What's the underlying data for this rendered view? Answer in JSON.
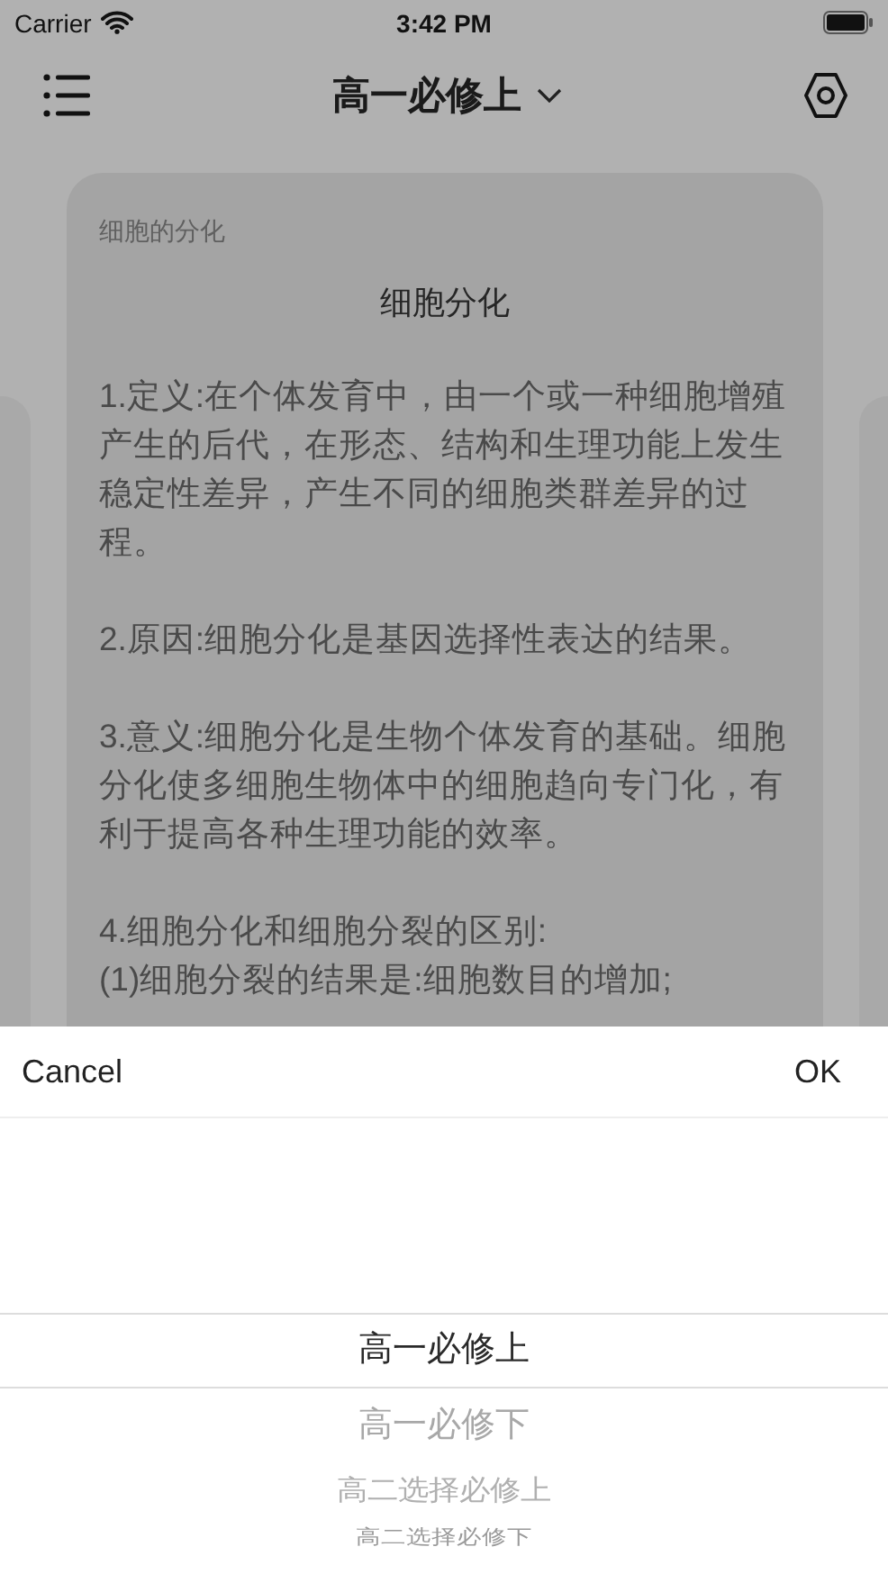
{
  "status_bar": {
    "carrier": "Carrier",
    "time": "3:42 PM"
  },
  "nav_bar": {
    "title": "高一必修上"
  },
  "card": {
    "category": "细胞的分化",
    "heading": "细胞分化",
    "paragraphs": [
      [
        "1.定义:在个体发育中，由一个或一种细胞增殖产生的后代，在形态、结构和生理功能上发生稳定性差异，产生不同的细胞类群差异的过程。"
      ],
      [
        "2.原因:细胞分化是基因选择性表达的结果。"
      ],
      [
        "3.意义:细胞分化是生物个体发育的基础。细胞分化使多细胞生物体中的细胞趋向专门化，有利于提高各种生理功能的效率。"
      ],
      [
        "4.细胞分化和细胞分裂的区别:",
        "(1)细胞分裂的结果是:细胞数目的增加;"
      ]
    ]
  },
  "picker": {
    "cancel": "Cancel",
    "ok": "OK",
    "options": [
      {
        "label": "高一必修上",
        "selected": true
      },
      {
        "label": "高一必修下",
        "selected": false
      },
      {
        "label": "高二选择必修上",
        "selected": false
      },
      {
        "label": "高二选择必修下",
        "selected": false
      }
    ]
  }
}
